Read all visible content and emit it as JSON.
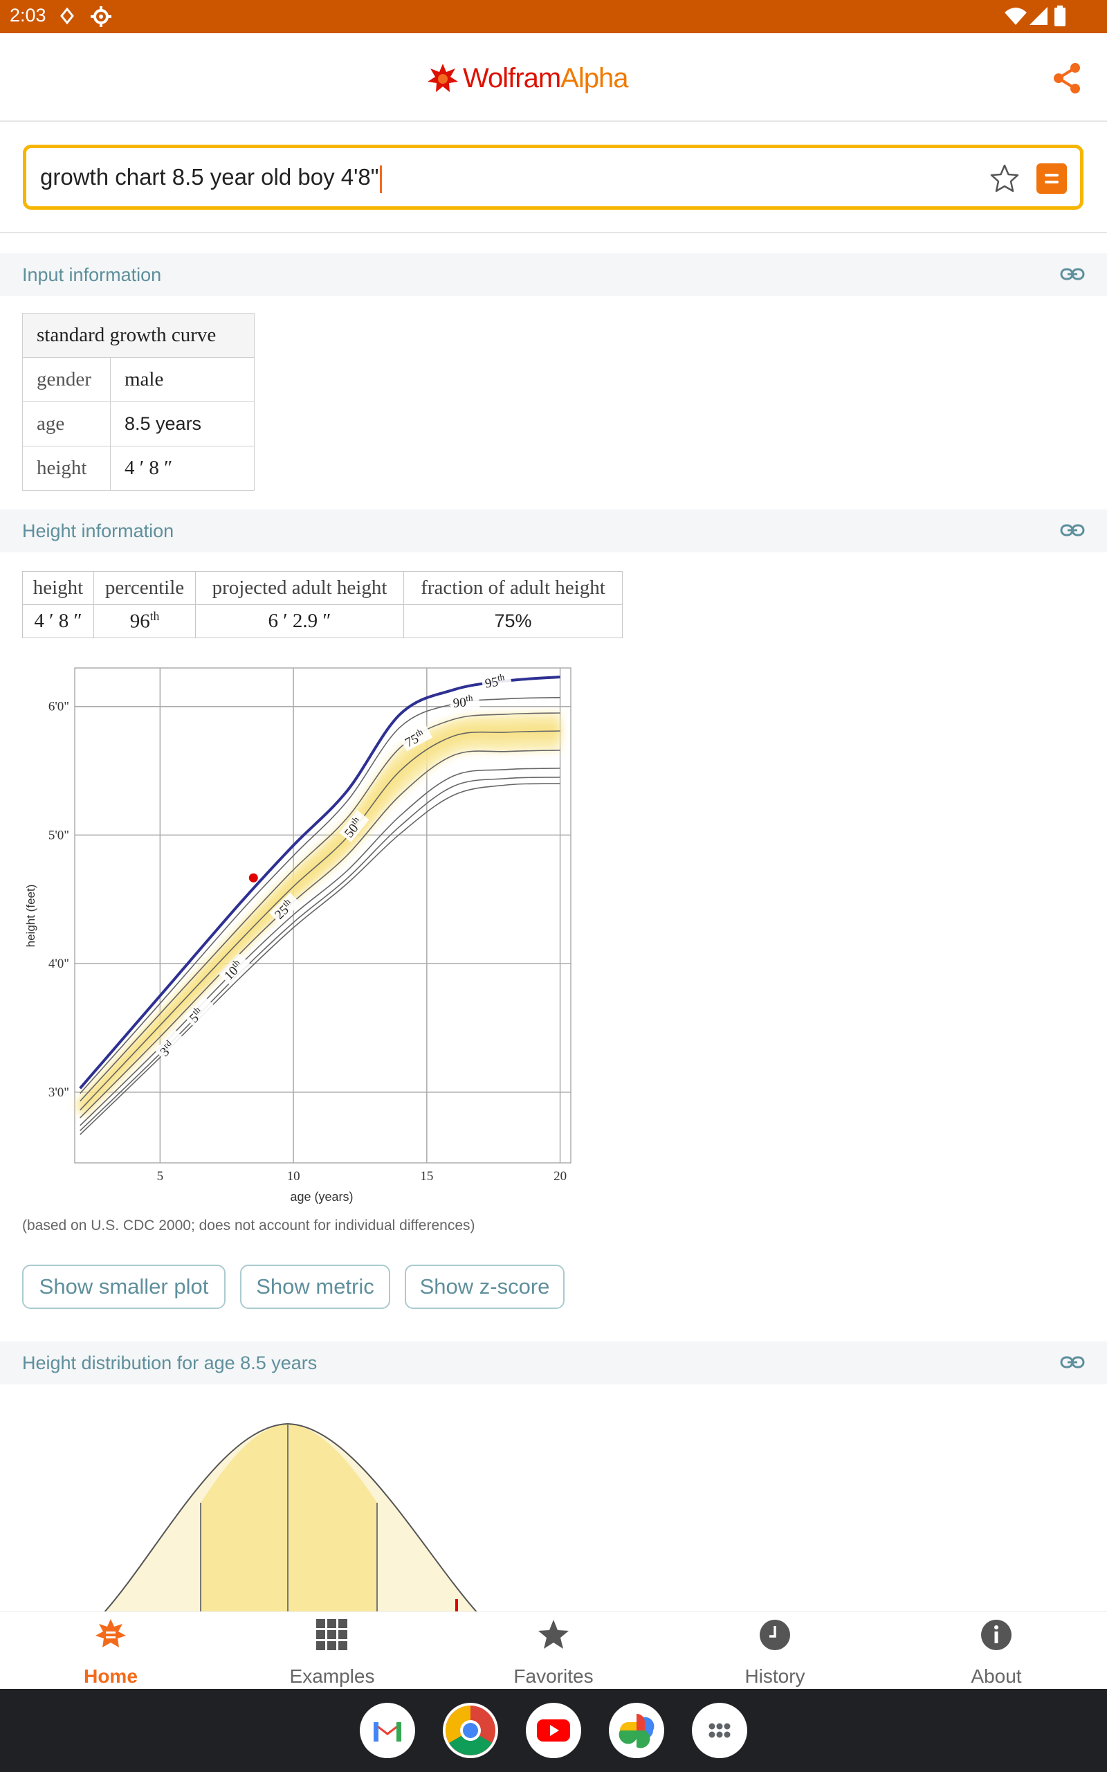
{
  "status_bar": {
    "time": "2:03"
  },
  "app": {
    "logo_part1": "Wolfram",
    "logo_part2": "Alpha"
  },
  "search": {
    "query": "growth chart 8.5 year old boy 4'8\""
  },
  "pods": {
    "input_information": {
      "title": "Input information",
      "table_header": "standard growth curve",
      "rows": [
        {
          "label": "gender",
          "value": "male"
        },
        {
          "label": "age",
          "value": "8.5 years"
        },
        {
          "label": "height",
          "value": "4 ′ 8 ″"
        }
      ]
    },
    "height_information": {
      "title": "Height information",
      "columns": [
        "height",
        "percentile",
        "projected adult height",
        "fraction of adult height"
      ],
      "values": {
        "height": "4 ′ 8 ″",
        "percentile_num": "96",
        "percentile_suffix": "th",
        "projected": "6 ′ 2.9 ″",
        "fraction": "75%"
      }
    },
    "height_distribution": {
      "title": "Height distribution for age 8.5 years"
    }
  },
  "chart_data": {
    "type": "line",
    "xlabel": "age (years)",
    "ylabel": "height (feet)",
    "xlim": [
      1.8,
      20.4
    ],
    "ylim": [
      2.45,
      6.3
    ],
    "x_ticks": [
      5,
      10,
      15,
      20
    ],
    "y_ticks": [
      {
        "value": 3,
        "label": "3'0\""
      },
      {
        "value": 4,
        "label": "4'0\""
      },
      {
        "value": 5,
        "label": "5'0\""
      },
      {
        "value": 6,
        "label": "6'0\""
      }
    ],
    "x": [
      2,
      5,
      8,
      10,
      12,
      14,
      16,
      18,
      20
    ],
    "series": [
      {
        "name": "3rd",
        "values": [
          2.67,
          3.27,
          3.89,
          4.28,
          4.62,
          5.01,
          5.31,
          5.39,
          5.4
        ]
      },
      {
        "name": "5th",
        "values": [
          2.7,
          3.3,
          3.93,
          4.32,
          4.66,
          5.07,
          5.38,
          5.44,
          5.45
        ]
      },
      {
        "name": "10th",
        "values": [
          2.74,
          3.35,
          3.99,
          4.38,
          4.72,
          5.15,
          5.46,
          5.51,
          5.52
        ]
      },
      {
        "name": "25th",
        "values": [
          2.8,
          3.43,
          4.08,
          4.48,
          4.84,
          5.31,
          5.62,
          5.65,
          5.66
        ]
      },
      {
        "name": "50th",
        "values": [
          2.86,
          3.52,
          4.18,
          4.6,
          4.98,
          5.5,
          5.77,
          5.8,
          5.81
        ]
      },
      {
        "name": "75th",
        "values": [
          2.93,
          3.61,
          4.29,
          4.73,
          5.13,
          5.68,
          5.9,
          5.94,
          5.95
        ]
      },
      {
        "name": "90th",
        "values": [
          2.99,
          3.69,
          4.4,
          4.84,
          5.26,
          5.84,
          6.02,
          6.06,
          6.07
        ]
      },
      {
        "name": "95th",
        "values": [
          3.03,
          3.75,
          4.47,
          4.92,
          5.34,
          5.94,
          6.13,
          6.2,
          6.23
        ]
      }
    ],
    "point": {
      "x": 8.5,
      "y": 4.667
    },
    "caption": "(based on U.S. CDC 2000; does not account for individual differences)"
  },
  "buttons": {
    "smaller_plot": "Show smaller plot",
    "metric": "Show metric",
    "zscore": "Show z-score"
  },
  "bottom_nav": [
    {
      "label": "Home",
      "icon": "home-icon"
    },
    {
      "label": "Examples",
      "icon": "grid-icon"
    },
    {
      "label": "Favorites",
      "icon": "star-icon"
    },
    {
      "label": "History",
      "icon": "clock-icon"
    },
    {
      "label": "About",
      "icon": "info-icon"
    }
  ],
  "dock": [
    "gmail-icon",
    "chrome-icon",
    "youtube-icon",
    "photos-icon",
    "app-drawer-icon"
  ],
  "colors": {
    "accent": "#f36a1a",
    "status_bar": "#cc5500",
    "pod_title": "#5e8f9c",
    "curve_95": "#2e3192",
    "marker": "#e00000",
    "band": "#f9e9a0"
  }
}
